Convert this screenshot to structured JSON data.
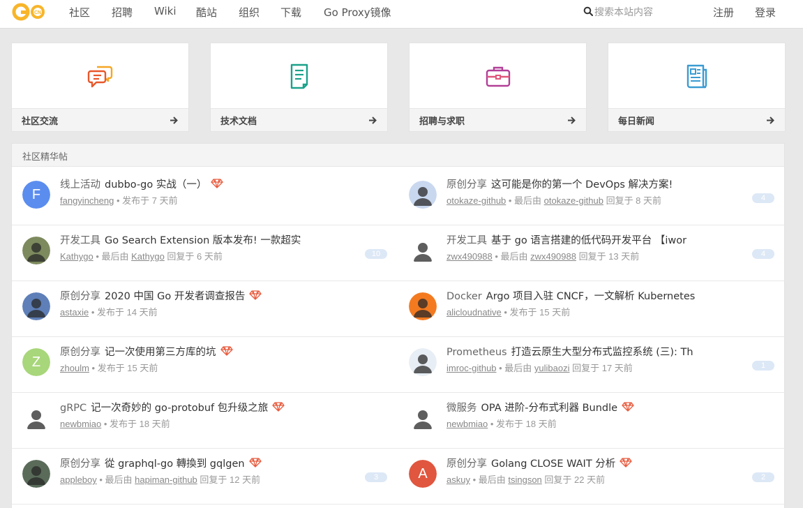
{
  "nav": {
    "logo_text": "GO",
    "logo_sub": "CN",
    "items": [
      "社区",
      "招聘",
      "Wiki",
      "酷站",
      "组织",
      "下载",
      "Go Proxy镜像"
    ],
    "search_placeholder": "搜索本站内容",
    "register": "注册",
    "login": "登录"
  },
  "cards": [
    {
      "label": "社区交流",
      "color": "#f08232"
    },
    {
      "label": "技术文档",
      "color": "#1aa18a"
    },
    {
      "label": "招聘与求职",
      "color": "#b23f97"
    },
    {
      "label": "每日新闻",
      "color": "#3a9bd1"
    }
  ],
  "panel": {
    "title": "社区精华帖"
  },
  "topics": [
    {
      "category": "线上活动",
      "title": "dubbo-go 实战（一）",
      "gem": true,
      "author": "fangyincheng",
      "meta_mid": " • 发布于 7 天前",
      "last": "",
      "meta_tail": "",
      "replies": "",
      "avatar_letter": "F",
      "avatar_color": "#5b8def"
    },
    {
      "category": "原创分享",
      "title": "这可能是你的第一个 DevOps 解决方案!",
      "gem": false,
      "author": "otokaze-github",
      "meta_mid": " • 最后由 ",
      "last": "otokaze-github",
      "meta_tail": " 回复于 8 天前",
      "replies": "4",
      "avatar_letter": "",
      "avatar_color": "#c9d8ef"
    },
    {
      "category": "开发工具",
      "title": "Go Search Extension 版本发布! 一款超实",
      "gem": false,
      "author": "Kathygo",
      "meta_mid": " • 最后由 ",
      "last": "Kathygo",
      "meta_tail": " 回复于 6 天前",
      "replies": "10",
      "avatar_letter": "",
      "avatar_color": "#7d8a5e"
    },
    {
      "category": "开发工具",
      "title": "基于 go 语言搭建的低代码开发平台 【iwor",
      "gem": false,
      "author": "zwx490988",
      "meta_mid": " • 最后由 ",
      "last": "zwx490988",
      "meta_tail": " 回复于 13 天前",
      "replies": "4",
      "avatar_letter": "",
      "avatar_color": "#ffffff"
    },
    {
      "category": "原创分享",
      "title": "2020 中国 Go 开发者调查报告",
      "gem": true,
      "author": "astaxie",
      "meta_mid": " • 发布于 14 天前",
      "last": "",
      "meta_tail": "",
      "replies": "",
      "avatar_letter": "",
      "avatar_color": "#5e7fb8"
    },
    {
      "category": "Docker",
      "title": "Argo 项目入驻 CNCF，一文解析 Kubernetes",
      "gem": false,
      "author": "alicloudnative",
      "meta_mid": " • 发布于 15 天前",
      "last": "",
      "meta_tail": "",
      "replies": "",
      "avatar_letter": "",
      "avatar_color": "#f47a20"
    },
    {
      "category": "原创分享",
      "title": "记一次使用第三方库的坑",
      "gem": true,
      "author": "zhoulm",
      "meta_mid": " • 发布于 15 天前",
      "last": "",
      "meta_tail": "",
      "replies": "",
      "avatar_letter": "Z",
      "avatar_color": "#a8d67a"
    },
    {
      "category": "Prometheus",
      "title": "打造云原生大型分布式监控系统 (三): Th",
      "gem": false,
      "author": "imroc-github",
      "meta_mid": " • 最后由 ",
      "last": "yulibaozi",
      "meta_tail": " 回复于 17 天前",
      "replies": "1",
      "avatar_letter": "",
      "avatar_color": "#e8eef5"
    },
    {
      "category": "gRPC",
      "title": "记一次奇妙的 go-protobuf 包升级之旅",
      "gem": true,
      "author": "newbmiao",
      "meta_mid": " • 发布于 18 天前",
      "last": "",
      "meta_tail": "",
      "replies": "",
      "avatar_letter": "",
      "avatar_color": "#ffffff"
    },
    {
      "category": "微服务",
      "title": "OPA 进阶-分布式利器 Bundle",
      "gem": true,
      "author": "newbmiao",
      "meta_mid": " • 发布于 18 天前",
      "last": "",
      "meta_tail": "",
      "replies": "",
      "avatar_letter": "",
      "avatar_color": "#ffffff"
    },
    {
      "category": "原创分享",
      "title": "從 graphql-go 轉換到 gqlgen",
      "gem": true,
      "author": "appleboy",
      "meta_mid": " • 最后由 ",
      "last": "hapiman-github",
      "meta_tail": " 回复于 12 天前",
      "replies": "3",
      "avatar_letter": "",
      "avatar_color": "#5a6b5a"
    },
    {
      "category": "原创分享",
      "title": "Golang CLOSE WAIT 分析",
      "gem": true,
      "author": "askuy",
      "meta_mid": " • 最后由 ",
      "last": "tsingson",
      "meta_tail": " 回复于 22 天前",
      "replies": "2",
      "avatar_letter": "A",
      "avatar_color": "#e0563f"
    }
  ]
}
